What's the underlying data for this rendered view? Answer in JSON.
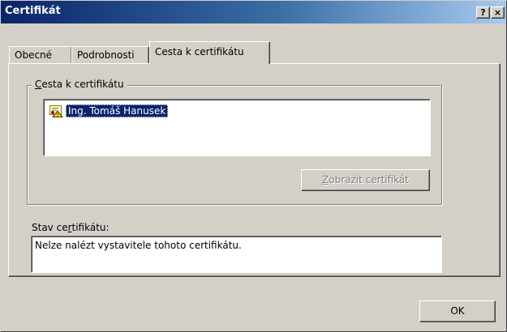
{
  "window": {
    "title": "Certifikát",
    "help_label": "?",
    "close_label": "×"
  },
  "tabs": [
    {
      "label": "Obecné",
      "active": false
    },
    {
      "label": "Podrobnosti",
      "active": false
    },
    {
      "label": "Cesta k certifikátu",
      "active": true
    }
  ],
  "cert_path": {
    "group_label_first": "C",
    "group_label_rest": "esta k certifikátu",
    "items": [
      {
        "label": "Ing. Tomáš Hanusek",
        "icon": "certificate-warning-icon",
        "selected": true
      }
    ],
    "view_button_first": "Z",
    "view_button_rest": "obrazit certifikát",
    "view_button_enabled": false
  },
  "status": {
    "label_pre": "Stav ce",
    "label_u": "r",
    "label_post": "tifikátu:",
    "text": "Nelze nalézt vystavitele tohoto certifikátu."
  },
  "footer": {
    "ok_label": "OK"
  },
  "colors": {
    "title_gradient_start": "#0a246a",
    "title_gradient_end": "#a6caf0",
    "face": "#d4d0c8",
    "selection": "#0a246a"
  }
}
